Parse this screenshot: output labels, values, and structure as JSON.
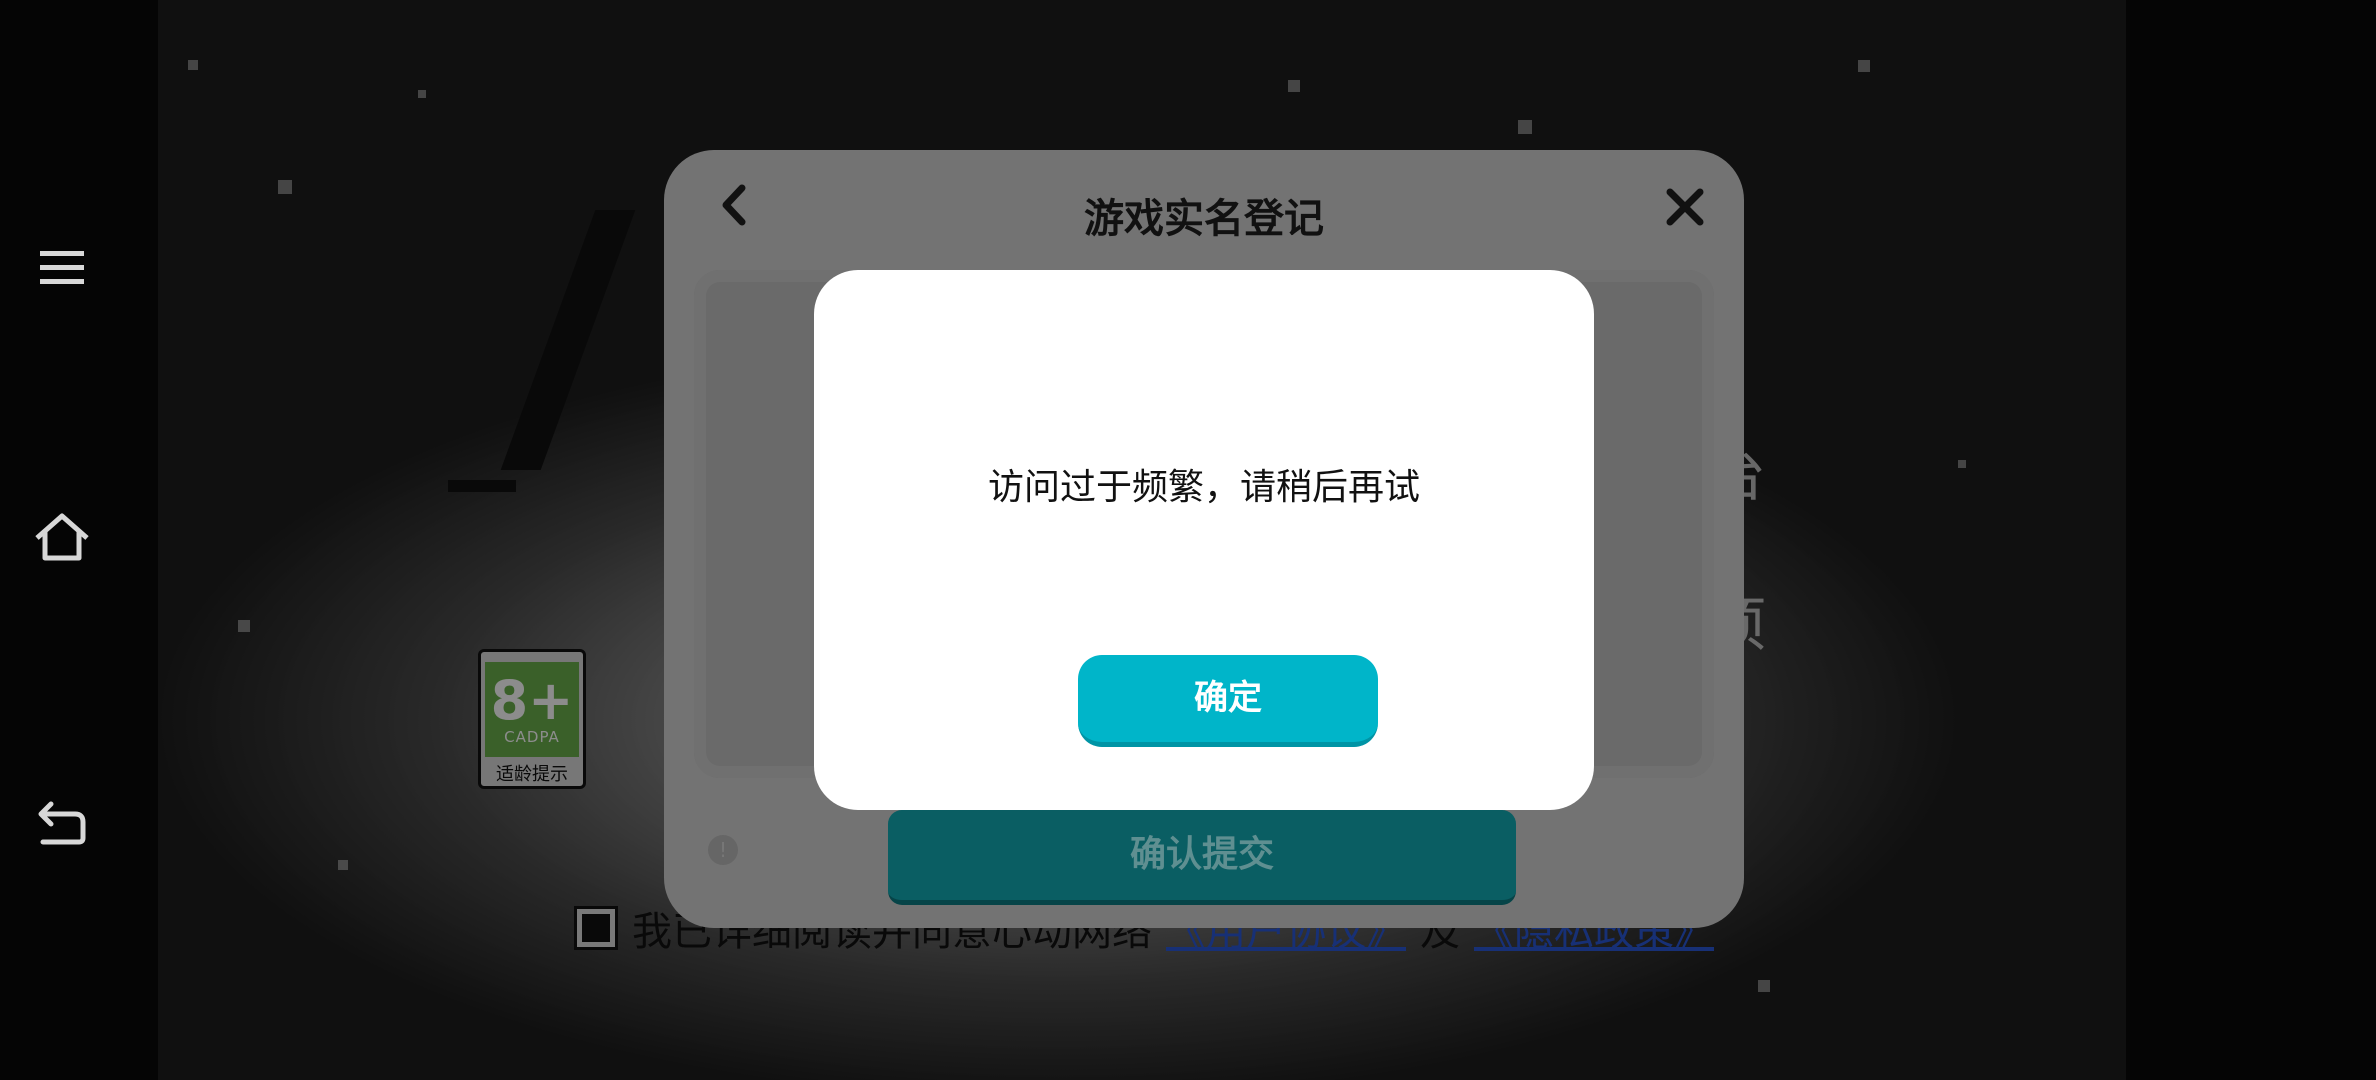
{
  "system_nav": {
    "menu_icon": "menu-icon",
    "home_icon": "home-icon",
    "back_icon": "back-arrow-icon"
  },
  "background": {
    "partial_text_right_1": "台",
    "partial_text_right_2": "项",
    "age_badge": {
      "rating": "8+",
      "org": "CADPA",
      "tip": "适龄提示"
    },
    "agreement": {
      "prefix": "我已详细阅读并同意心动网络",
      "user_agreement": "《用户协议》",
      "and": "及",
      "privacy_policy": "《隐私政策》"
    }
  },
  "registration": {
    "title": "游戏实名登记",
    "back_icon": "chevron-left-icon",
    "close_icon": "close-icon",
    "submit_label": "确认提交"
  },
  "alert": {
    "message": "访问过于频繁，请稍后再试",
    "ok_label": "确定"
  },
  "colors": {
    "accent": "#00b5c9",
    "submit_dim": "#0a5e63",
    "badge_green": "#6ab04c"
  }
}
